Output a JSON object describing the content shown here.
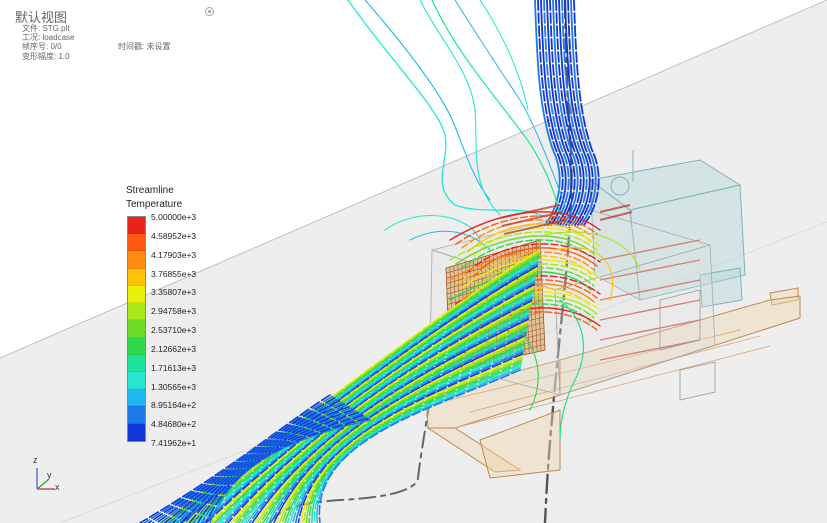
{
  "info_panel": {
    "title": "默认视图",
    "file": "文件: STG.plt",
    "load_case": "工况: loadcase",
    "frame": "帧序号: 0/0",
    "time": "时间戳: 未设置",
    "deform": "变形幅度: 1.0"
  },
  "legend": {
    "title_line1": "Streamline",
    "title_line2": "Temperature",
    "colors": [
      "#e8231c",
      "#ff5a10",
      "#ff8c10",
      "#ffc40a",
      "#e8f00a",
      "#a8e81a",
      "#6cdc24",
      "#2ed84a",
      "#1ee29a",
      "#26e6d2",
      "#20b8f0",
      "#1a7ae8",
      "#1236d8"
    ],
    "labels": [
      "5.00000e+3",
      "4.58952e+3",
      "4.17903e+3",
      "3.76855e+3",
      "3.35807e+3",
      "2.94758e+3",
      "2.53710e+3",
      "2.12662e+3",
      "1.71613e+3",
      "1.30565e+3",
      "8.95164e+2",
      "4.84680e+2",
      "7.41962e+1"
    ]
  },
  "axes": {
    "z": "z",
    "y": "y",
    "x": "x"
  },
  "colors": {
    "floor_line": "#c8c8c8",
    "model_tan": "#c08850",
    "model_teal": "#80b4b4"
  }
}
